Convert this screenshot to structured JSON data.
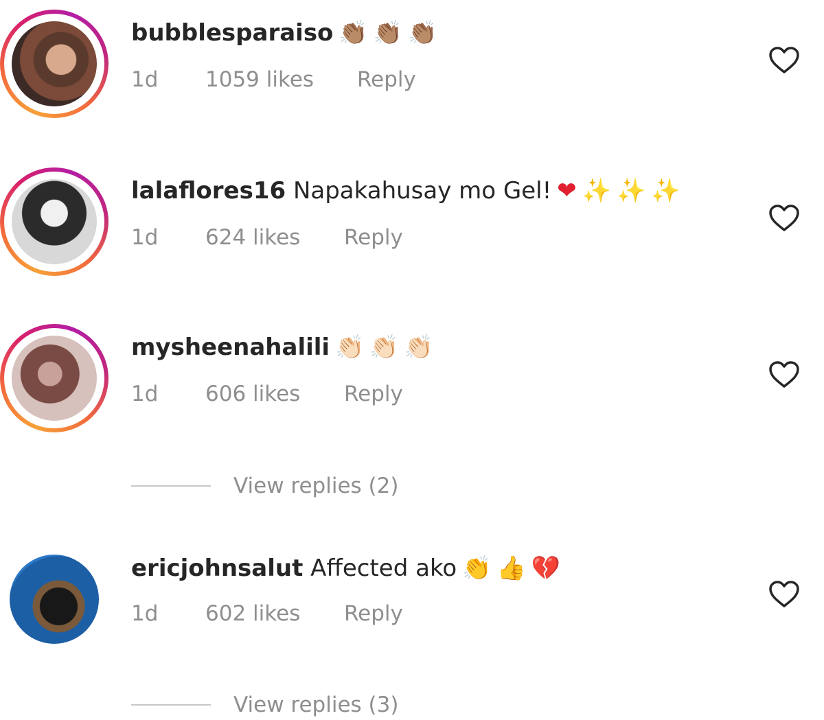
{
  "comments": [
    {
      "username": "bubblesparaiso",
      "text": "",
      "emojis": [
        "👏🏽",
        "👏🏽",
        "👏🏽"
      ],
      "time": "1d",
      "likes": "1059 likes",
      "reply": "Reply"
    },
    {
      "username": "lalaflores16",
      "text": "Napakahusay mo Gel!",
      "emojis": [
        "❤",
        "✨",
        "✨",
        "✨"
      ],
      "time": "1d",
      "likes": "624 likes",
      "reply": "Reply"
    },
    {
      "username": "mysheenahalili",
      "text": "",
      "emojis": [
        "👏🏻",
        "👏🏻",
        "👏🏻"
      ],
      "time": "1d",
      "likes": "606 likes",
      "reply": "Reply"
    },
    {
      "username": "ericjohnsalut",
      "text": "Affected ako",
      "emojis": [
        "👏",
        "👍",
        "💔"
      ],
      "time": "1d",
      "likes": "602 likes",
      "reply": "Reply"
    }
  ],
  "view_replies": [
    {
      "label": "View replies (2)"
    },
    {
      "label": "View replies (3)"
    }
  ],
  "colors": {
    "text": "#262626",
    "secondary": "#8e8e8e",
    "story_ring": [
      "#f7a13a",
      "#d8206c",
      "#b31ea5"
    ]
  },
  "icons": {
    "like": "heart-outline-icon"
  }
}
